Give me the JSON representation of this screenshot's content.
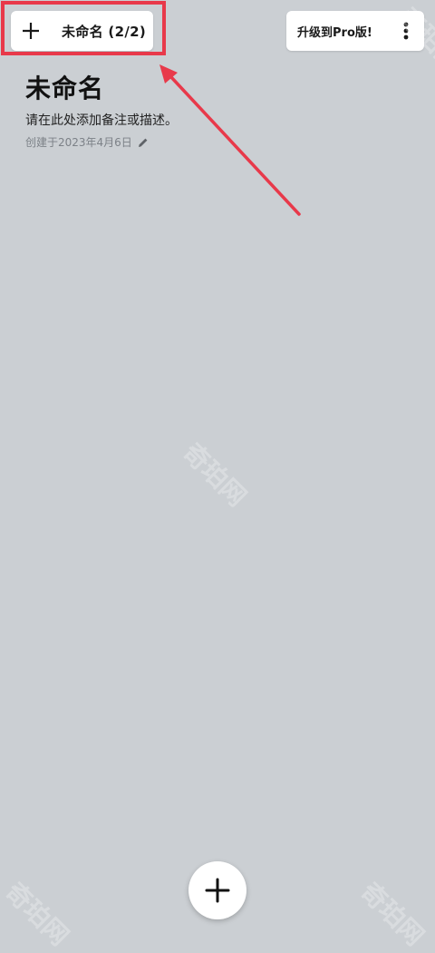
{
  "tab": {
    "add_icon": "plus-icon",
    "title": "未命名 (2/2)"
  },
  "toolbar": {
    "upgrade_label": "升级到Pro版!",
    "more_icon": "more-vertical-icon"
  },
  "board": {
    "title": "未命名",
    "description": "请在此处添加备注或描述。",
    "created": "创建于2023年4月6日",
    "edit_icon": "pencil-icon"
  },
  "fab": {
    "icon": "plus-icon"
  },
  "watermark": {
    "text": "奇珀网"
  },
  "colors": {
    "background": "#cbcfd3",
    "surface": "#ffffff",
    "annotation": "#e8394a",
    "text_primary": "#111111",
    "text_secondary": "#7c8187"
  }
}
